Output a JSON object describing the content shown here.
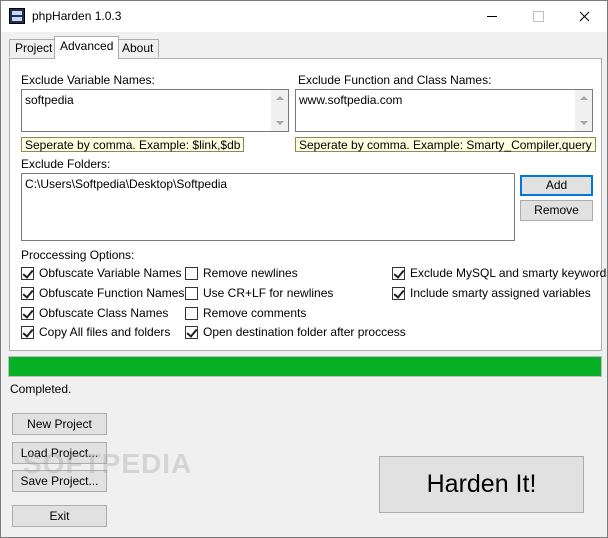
{
  "window": {
    "title": "phpHarden 1.0.3"
  },
  "tabs": [
    {
      "label": "Project",
      "active": false
    },
    {
      "label": "Advanced",
      "active": true
    },
    {
      "label": "About",
      "active": false
    }
  ],
  "advanced": {
    "exclude_vars_label": "Exclude Variable Names:",
    "exclude_vars_value": "softpedia",
    "exclude_vars_hint": "Seperate by comma. Example: $link,$db",
    "exclude_funcs_label": "Exclude Function and Class Names:",
    "exclude_funcs_value": "www.softpedia.com",
    "exclude_funcs_hint": "Seperate by comma. Example: Smarty_Compiler,query",
    "exclude_folders_label": "Exclude Folders:",
    "folders": [
      "C:\\Users\\Softpedia\\Desktop\\Softpedia"
    ],
    "add_label": "Add",
    "remove_label": "Remove",
    "options_label": "Proccessing Options:",
    "options": [
      {
        "label": "Obfuscate Variable Names",
        "checked": true
      },
      {
        "label": "Obfuscate Function Names",
        "checked": true
      },
      {
        "label": "Obfuscate Class Names",
        "checked": true
      },
      {
        "label": "Copy All files and folders",
        "checked": true
      },
      {
        "label": "Remove newlines",
        "checked": false
      },
      {
        "label": "Use CR+LF for newlines",
        "checked": false
      },
      {
        "label": "Remove comments",
        "checked": false
      },
      {
        "label": "Open destination folder after proccess",
        "checked": true
      },
      {
        "label": "Exclude MySQL and smarty keywords",
        "checked": true
      },
      {
        "label": "Include smarty assigned variables",
        "checked": true
      }
    ]
  },
  "progress": {
    "value": 1.0,
    "color": "#06b025"
  },
  "status": "Completed.",
  "buttons": {
    "new_project": "New Project",
    "load_project": "Load Project...",
    "save_project": "Save Project...",
    "exit": "Exit",
    "harden": "Harden It!"
  },
  "watermark": "SOFTPEDIA"
}
